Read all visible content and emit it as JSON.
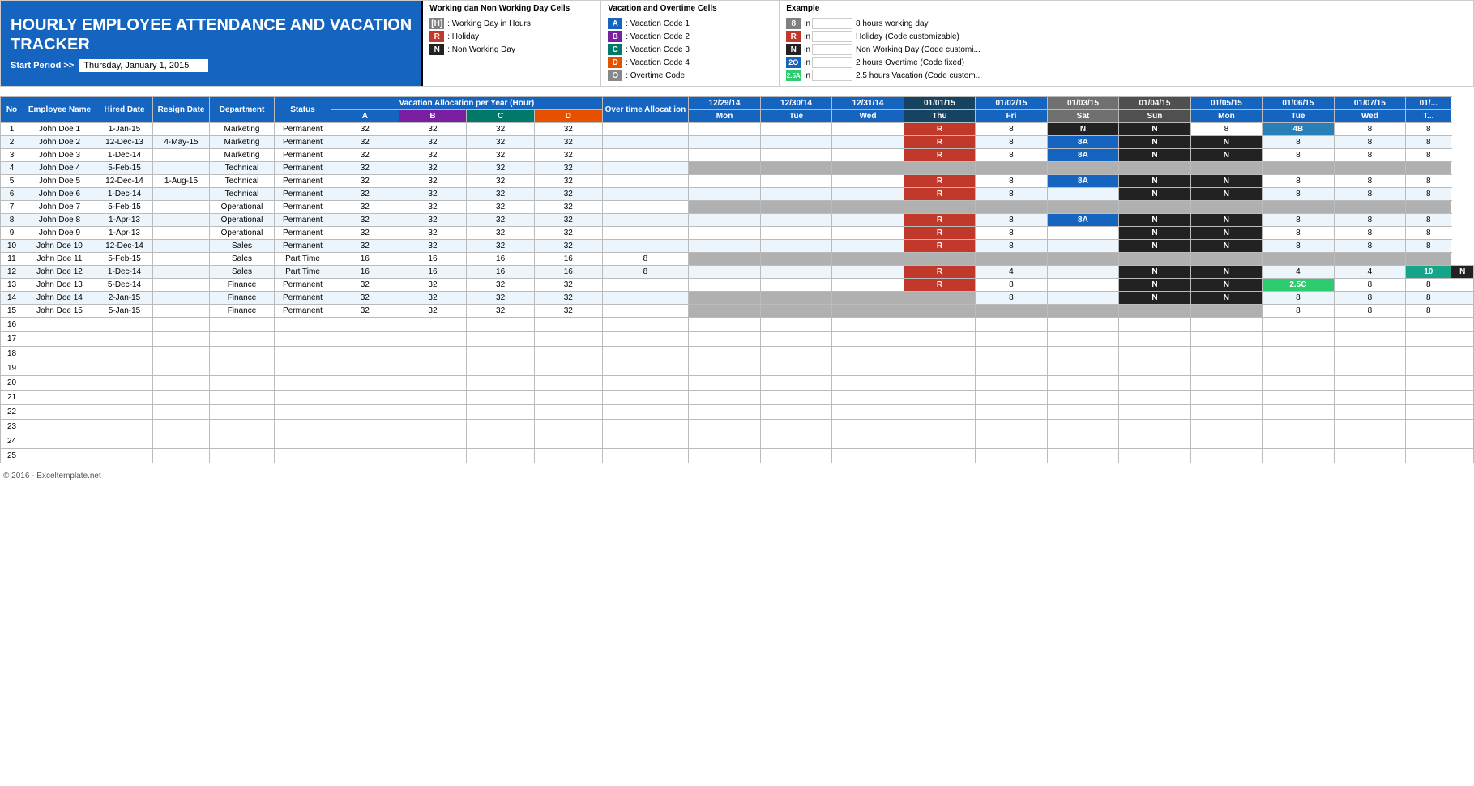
{
  "header": {
    "title_line1": "HOURLY EMPLOYEE ATTENDANCE AND VACATION",
    "title_line2": "TRACKER",
    "start_period_label": "Start Period >>",
    "start_period_value": "Thursday, January 1, 2015"
  },
  "working_legend": {
    "title": "Working dan Non Working Day Cells",
    "items": [
      {
        "code": "[H]",
        "style": "gray",
        "desc": "Working Day in Hours"
      },
      {
        "code": "R",
        "style": "red",
        "desc": "Holiday"
      },
      {
        "code": "N",
        "style": "black",
        "desc": "Non Working Day"
      }
    ]
  },
  "vacation_legend": {
    "title": "Vacation and Overtime Cells",
    "items": [
      {
        "code": "A",
        "style": "vacation-code-a",
        "desc": "Vacation Code 1"
      },
      {
        "code": "B",
        "style": "vacation-code-b",
        "desc": "Vacation Code 2"
      },
      {
        "code": "C",
        "style": "vacation-code-c",
        "desc": "Vacation Code 3"
      },
      {
        "code": "D",
        "style": "vacation-code-d",
        "desc": "Vacation Code 4"
      },
      {
        "code": "O",
        "style": "vacation-code-o",
        "desc": "Overtime Code"
      }
    ]
  },
  "example": {
    "title": "Example",
    "items": [
      {
        "box": "8",
        "box_style": "gray",
        "in": "in",
        "label": "8 hours working day"
      },
      {
        "box": "R",
        "box_style": "red",
        "in": "in",
        "label": "Holiday (Code customizable)"
      },
      {
        "box": "N",
        "box_style": "black",
        "in": "in",
        "label": "Non Working Day (Code customi..."
      },
      {
        "box": "2O",
        "box_style": "blue",
        "in": "in",
        "label": "2 hours Overtime (Code fixed)"
      },
      {
        "box": "2.5A",
        "box_style": "teal",
        "in": "in",
        "label": "2.5 hours Vacation (Code custom..."
      }
    ]
  },
  "table": {
    "headers": {
      "no": "No",
      "name": "Employee Name",
      "hired": "Hired Date",
      "resign": "Resign Date",
      "dept": "Department",
      "status": "Status",
      "alloc": "Vacation Allocation per Year (Hour)",
      "overtime": "Over time Allocat ion",
      "alloc_codes": [
        "A",
        "B",
        "C",
        "D"
      ]
    },
    "dates": [
      {
        "date": "12/29/14",
        "day": "Mon"
      },
      {
        "date": "12/30/14",
        "day": "Tue"
      },
      {
        "date": "12/31/14",
        "day": "Wed"
      },
      {
        "date": "01/01/15",
        "day": "Thu"
      },
      {
        "date": "01/02/15",
        "day": "Fri"
      },
      {
        "date": "01/03/15",
        "day": "Sat"
      },
      {
        "date": "01/04/15",
        "day": "Sun"
      },
      {
        "date": "01/05/15",
        "day": "Mon"
      },
      {
        "date": "01/06/15",
        "day": "Tue"
      },
      {
        "date": "01/07/15",
        "day": "Wed"
      },
      {
        "date": "01/...",
        "day": "T..."
      }
    ],
    "rows": [
      {
        "no": 1,
        "name": "John Doe 1",
        "hired": "1-Jan-15",
        "resign": "",
        "dept": "Marketing",
        "status": "Permanent",
        "a": 32,
        "b": 32,
        "c": 32,
        "d": 32,
        "ot": "",
        "d1229": "",
        "d1230": "",
        "d1231": "",
        "d0101": "R",
        "d0102": "8",
        "d0103": "N",
        "d0104": "N",
        "d0105": "8",
        "d0106": "4B",
        "d0107": "8",
        "d01x": "8"
      },
      {
        "no": 2,
        "name": "John Doe 2",
        "hired": "12-Dec-13",
        "resign": "4-May-15",
        "dept": "Marketing",
        "status": "Permanent",
        "a": 32,
        "b": 32,
        "c": 32,
        "d": 32,
        "ot": "",
        "d1229": "",
        "d1230": "",
        "d1231": "",
        "d0101": "R",
        "d0102": "8",
        "d0103": "8A",
        "d0104": "N",
        "d0105": "N",
        "d0106": "8",
        "d0107": "8",
        "d01x": "8"
      },
      {
        "no": 3,
        "name": "John Doe 3",
        "hired": "1-Dec-14",
        "resign": "",
        "dept": "Marketing",
        "status": "Permanent",
        "a": 32,
        "b": 32,
        "c": 32,
        "d": 32,
        "ot": "",
        "d1229": "",
        "d1230": "",
        "d1231": "",
        "d0101": "R",
        "d0102": "8",
        "d0103": "8A",
        "d0104": "N",
        "d0105": "N",
        "d0106": "8",
        "d0107": "8",
        "d01x": "8"
      },
      {
        "no": 4,
        "name": "John Doe 4",
        "hired": "5-Feb-15",
        "resign": "",
        "dept": "Technical",
        "status": "Permanent",
        "a": 32,
        "b": 32,
        "c": 32,
        "d": 32,
        "ot": "",
        "d1229": "",
        "d1230": "",
        "d1231": "",
        "d0101": "",
        "d0102": "",
        "d0103": "",
        "d0104": "",
        "d0105": "",
        "d0106": "",
        "d0107": "",
        "d01x": ""
      },
      {
        "no": 5,
        "name": "John Doe 5",
        "hired": "12-Dec-14",
        "resign": "1-Aug-15",
        "dept": "Technical",
        "status": "Permanent",
        "a": 32,
        "b": 32,
        "c": 32,
        "d": 32,
        "ot": "",
        "d1229": "",
        "d1230": "",
        "d1231": "",
        "d0101": "R",
        "d0102": "8",
        "d0103": "8A",
        "d0104": "N",
        "d0105": "N",
        "d0106": "8",
        "d0107": "8",
        "d01x": "8"
      },
      {
        "no": 6,
        "name": "John Doe 6",
        "hired": "1-Dec-14",
        "resign": "",
        "dept": "Technical",
        "status": "Permanent",
        "a": 32,
        "b": 32,
        "c": 32,
        "d": 32,
        "ot": "",
        "d1229": "",
        "d1230": "",
        "d1231": "",
        "d0101": "R",
        "d0102": "8",
        "d0103": "",
        "d0104": "N",
        "d0105": "N",
        "d0106": "8",
        "d0107": "8",
        "d01x": "8"
      },
      {
        "no": 7,
        "name": "John Doe 7",
        "hired": "5-Feb-15",
        "resign": "",
        "dept": "Operational",
        "status": "Permanent",
        "a": 32,
        "b": 32,
        "c": 32,
        "d": 32,
        "ot": "",
        "d1229": "",
        "d1230": "",
        "d1231": "",
        "d0101": "",
        "d0102": "",
        "d0103": "",
        "d0104": "",
        "d0105": "",
        "d0106": "",
        "d0107": "",
        "d01x": ""
      },
      {
        "no": 8,
        "name": "John Doe 8",
        "hired": "1-Apr-13",
        "resign": "",
        "dept": "Operational",
        "status": "Permanent",
        "a": 32,
        "b": 32,
        "c": 32,
        "d": 32,
        "ot": "",
        "d1229": "",
        "d1230": "",
        "d1231": "",
        "d0101": "R",
        "d0102": "8",
        "d0103": "8A",
        "d0104": "N",
        "d0105": "N",
        "d0106": "8",
        "d0107": "8",
        "d01x": "8"
      },
      {
        "no": 9,
        "name": "John Doe 9",
        "hired": "1-Apr-13",
        "resign": "",
        "dept": "Operational",
        "status": "Permanent",
        "a": 32,
        "b": 32,
        "c": 32,
        "d": 32,
        "ot": "",
        "d1229": "",
        "d1230": "",
        "d1231": "",
        "d0101": "R",
        "d0102": "8",
        "d0103": "",
        "d0104": "N",
        "d0105": "N",
        "d0106": "8",
        "d0107": "8",
        "d01x": "8"
      },
      {
        "no": 10,
        "name": "John Doe 10",
        "hired": "12-Dec-14",
        "resign": "",
        "dept": "Sales",
        "status": "Permanent",
        "a": 32,
        "b": 32,
        "c": 32,
        "d": 32,
        "ot": "",
        "d1229": "",
        "d1230": "",
        "d1231": "",
        "d0101": "R",
        "d0102": "8",
        "d0103": "",
        "d0104": "N",
        "d0105": "N",
        "d0106": "8",
        "d0107": "8",
        "d01x": "8"
      },
      {
        "no": 11,
        "name": "John Doe 11",
        "hired": "5-Feb-15",
        "resign": "",
        "dept": "Sales",
        "status": "Part Time",
        "a": 16,
        "b": 16,
        "c": 16,
        "d": 16,
        "ot": "8",
        "d1229": "",
        "d1230": "",
        "d1231": "",
        "d0101": "",
        "d0102": "",
        "d0103": "",
        "d0104": "",
        "d0105": "",
        "d0106": "",
        "d0107": "",
        "d01x": ""
      },
      {
        "no": 12,
        "name": "John Doe 12",
        "hired": "1-Dec-14",
        "resign": "",
        "dept": "Sales",
        "status": "Part Time",
        "a": 16,
        "b": 16,
        "c": 16,
        "d": 16,
        "ot": "8",
        "d1229": "",
        "d1230": "",
        "d1231": "",
        "d0101": "R",
        "d0102": "4",
        "d0103": "",
        "d0104": "N",
        "d0105": "N",
        "d0106": "4",
        "d0107": "4",
        "d01x": "10"
      },
      {
        "no": 13,
        "name": "John Doe 13",
        "hired": "5-Dec-14",
        "resign": "",
        "dept": "Finance",
        "status": "Permanent",
        "a": 32,
        "b": 32,
        "c": 32,
        "d": 32,
        "ot": "",
        "d1229": "",
        "d1230": "",
        "d1231": "",
        "d0101": "R",
        "d0102": "8",
        "d0103": "",
        "d0104": "N",
        "d0105": "N",
        "d0106": "2.5C",
        "d0107": "8",
        "d01x": "8"
      },
      {
        "no": 14,
        "name": "John Doe 14",
        "hired": "2-Jan-15",
        "resign": "",
        "dept": "Finance",
        "status": "Permanent",
        "a": 32,
        "b": 32,
        "c": 32,
        "d": 32,
        "ot": "",
        "d1229": "",
        "d1230": "",
        "d1231": "",
        "d0101": "",
        "d0102": "8",
        "d0103": "",
        "d0104": "N",
        "d0105": "N",
        "d0106": "8",
        "d0107": "8",
        "d01x": "8"
      },
      {
        "no": 15,
        "name": "John Doe 15",
        "hired": "5-Jan-15",
        "resign": "",
        "dept": "Finance",
        "status": "Permanent",
        "a": 32,
        "b": 32,
        "c": 32,
        "d": 32,
        "ot": "",
        "d1229": "",
        "d1230": "",
        "d1231": "",
        "d0101": "",
        "d0102": "",
        "d0103": "",
        "d0104": "",
        "d0105": "",
        "d0106": "8",
        "d0107": "8",
        "d01x": "8"
      },
      {
        "no": 16,
        "name": "",
        "hired": "",
        "resign": "",
        "dept": "",
        "status": "",
        "a": "",
        "b": "",
        "c": "",
        "d": "",
        "ot": ""
      },
      {
        "no": 17,
        "name": "",
        "hired": "",
        "resign": "",
        "dept": "",
        "status": "",
        "a": "",
        "b": "",
        "c": "",
        "d": "",
        "ot": ""
      },
      {
        "no": 18,
        "name": "",
        "hired": "",
        "resign": "",
        "dept": "",
        "status": "",
        "a": "",
        "b": "",
        "c": "",
        "d": "",
        "ot": ""
      },
      {
        "no": 19,
        "name": "",
        "hired": "",
        "resign": "",
        "dept": "",
        "status": "",
        "a": "",
        "b": "",
        "c": "",
        "d": "",
        "ot": ""
      },
      {
        "no": 20,
        "name": "",
        "hired": "",
        "resign": "",
        "dept": "",
        "status": "",
        "a": "",
        "b": "",
        "c": "",
        "d": "",
        "ot": ""
      },
      {
        "no": 21,
        "name": "",
        "hired": "",
        "resign": "",
        "dept": "",
        "status": "",
        "a": "",
        "b": "",
        "c": "",
        "d": "",
        "ot": ""
      },
      {
        "no": 22,
        "name": "",
        "hired": "",
        "resign": "",
        "dept": "",
        "status": "",
        "a": "",
        "b": "",
        "c": "",
        "d": "",
        "ot": ""
      },
      {
        "no": 23,
        "name": "",
        "hired": "",
        "resign": "",
        "dept": "",
        "status": "",
        "a": "",
        "b": "",
        "c": "",
        "d": "",
        "ot": ""
      },
      {
        "no": 24,
        "name": "",
        "hired": "",
        "resign": "",
        "dept": "",
        "status": "",
        "a": "",
        "b": "",
        "c": "",
        "d": "",
        "ot": ""
      },
      {
        "no": 25,
        "name": "",
        "hired": "",
        "resign": "",
        "dept": "",
        "status": "",
        "a": "",
        "b": "",
        "c": "",
        "d": "",
        "ot": ""
      }
    ]
  },
  "footer": {
    "copyright": "© 2016 - Exceltemplate.net"
  }
}
